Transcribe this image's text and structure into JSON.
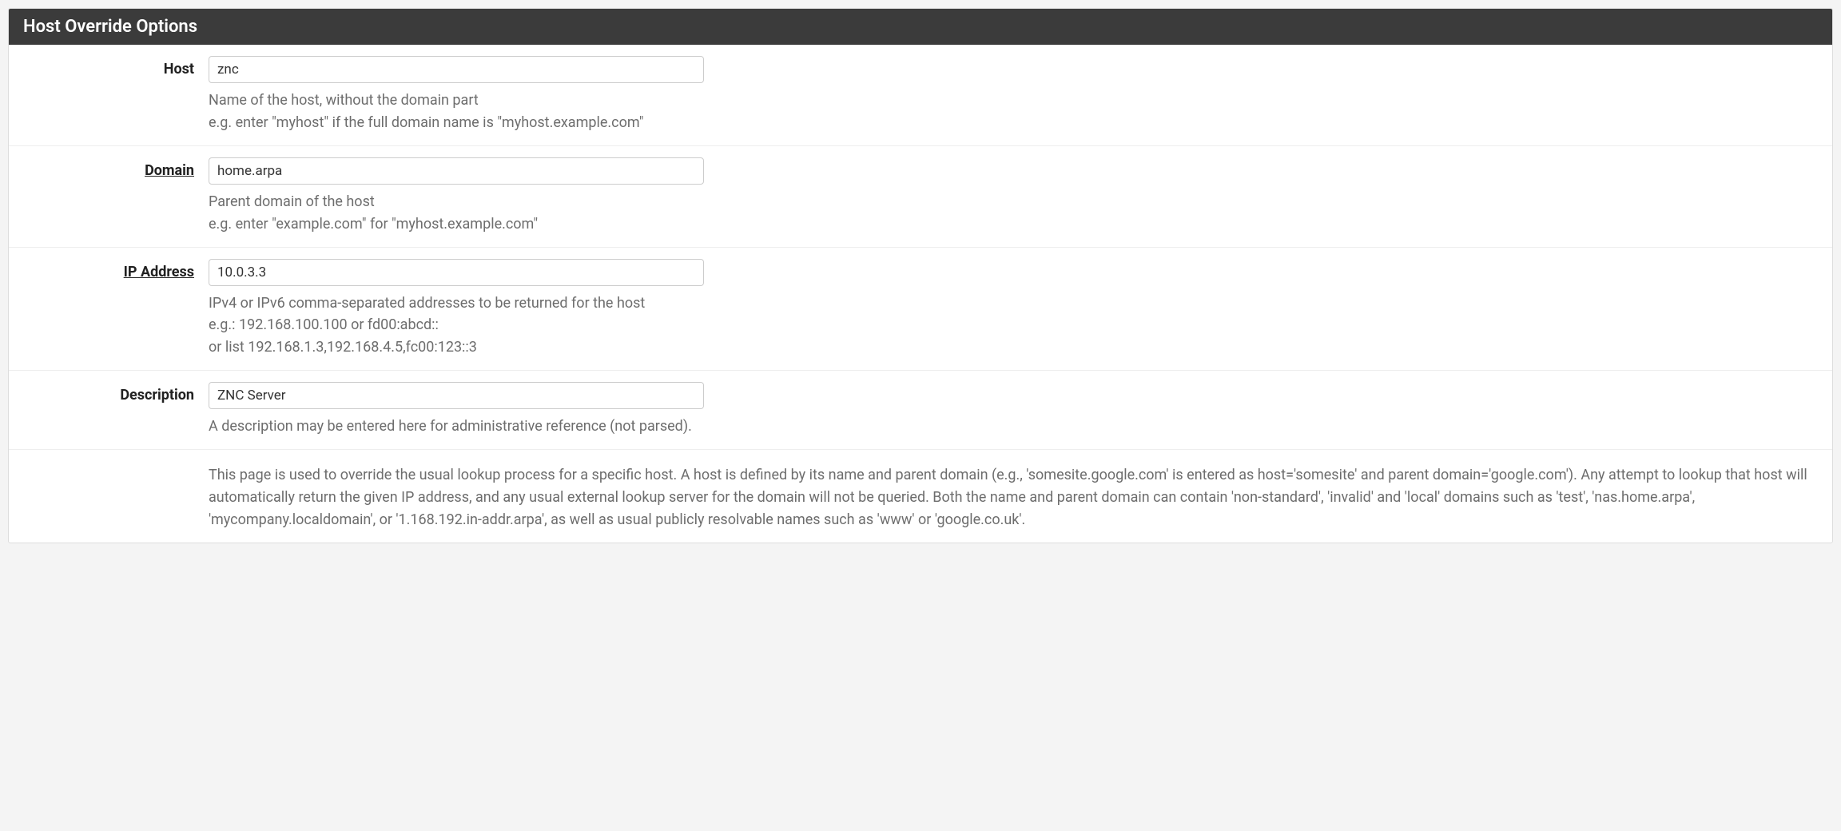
{
  "panel": {
    "title": "Host Override Options"
  },
  "fields": {
    "host": {
      "label": "Host",
      "value": "znc",
      "help1": "Name of the host, without the domain part",
      "help2": "e.g. enter \"myhost\" if the full domain name is \"myhost.example.com\""
    },
    "domain": {
      "label": "Domain",
      "value": "home.arpa",
      "help1": "Parent domain of the host",
      "help2": "e.g. enter \"example.com\" for \"myhost.example.com\""
    },
    "ip": {
      "label": "IP Address",
      "value": "10.0.3.3",
      "help1": "IPv4 or IPv6 comma-separated addresses to be returned for the host",
      "help2": "e.g.: 192.168.100.100 or fd00:abcd::",
      "help3": "or list 192.168.1.3,192.168.4.5,fc00:123::3"
    },
    "description": {
      "label": "Description",
      "value": "ZNC Server",
      "help1": "A description may be entered here for administrative reference (not parsed)."
    }
  },
  "info": "This page is used to override the usual lookup process for a specific host. A host is defined by its name and parent domain (e.g., 'somesite.google.com' is entered as host='somesite' and parent domain='google.com'). Any attempt to lookup that host will automatically return the given IP address, and any usual external lookup server for the domain will not be queried. Both the name and parent domain can contain 'non-standard', 'invalid' and 'local' domains such as 'test', 'nas.home.arpa', 'mycompany.localdomain', or '1.168.192.in-addr.arpa', as well as usual publicly resolvable names such as 'www' or 'google.co.uk'."
}
